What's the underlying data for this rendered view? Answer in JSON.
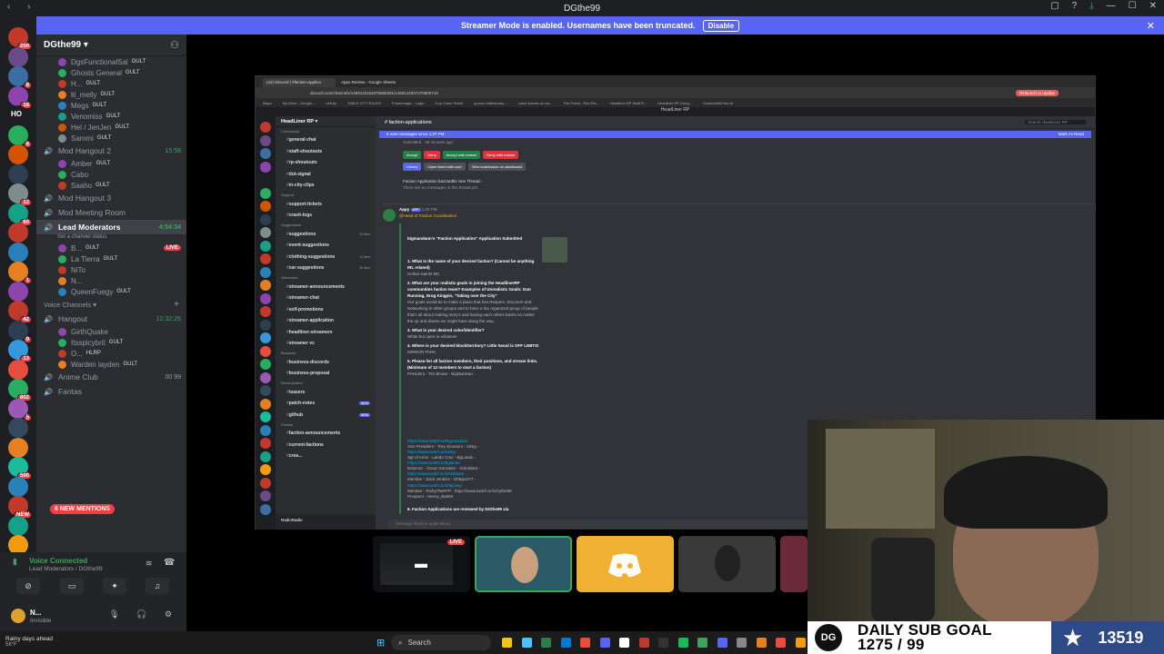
{
  "window": {
    "title": "DGthe99"
  },
  "banner": {
    "text": "Streamer Mode is enabled. Usernames have been truncated.",
    "disable_label": "Disable"
  },
  "rail_badges": [
    "250",
    "8",
    "18",
    "6",
    "HO",
    "12",
    "60",
    "1",
    "42",
    "9",
    "13",
    "802",
    "5",
    "500",
    "NEW"
  ],
  "server": {
    "name": "DGthe99"
  },
  "voice_users_top": [
    {
      "name": "DgsFunctionalSal",
      "tag": "GULT"
    },
    {
      "name": "Ghosts General",
      "tag": "GULT"
    },
    {
      "name": "H...",
      "tag": "GULT"
    },
    {
      "name": "lil_melly",
      "tag": "GULT"
    },
    {
      "name": "Megs",
      "tag": "GULT"
    },
    {
      "name": "Venomiss",
      "tag": "GULT"
    },
    {
      "name": "Hel / JenJen",
      "tag": "GULT"
    },
    {
      "name": "Sammi",
      "tag": "GULT"
    }
  ],
  "mod_hangout_2": {
    "name": "Mod Hangout 2",
    "time": "15:58"
  },
  "mod_hangout_2_users": [
    {
      "name": "Amber",
      "tag": "GULT"
    },
    {
      "name": "Cabo",
      "tag": ""
    },
    {
      "name": "Saaho",
      "tag": "GULT"
    }
  ],
  "mod_hangout_3": {
    "name": "Mod Hangout 3"
  },
  "mod_meeting": {
    "name": "Mod Meeting Room"
  },
  "lead_mods": {
    "name": "Lead Moderators",
    "time": "4:54:34",
    "status": "Set a channel status"
  },
  "lead_mod_users": [
    {
      "name": "B...",
      "tag": "GULT",
      "live": "LIVE"
    },
    {
      "name": "La Tierra",
      "tag": "GULT",
      "live": ""
    },
    {
      "name": "NiTo",
      "tag": "",
      "live": ""
    },
    {
      "name": "N...",
      "tag": "",
      "live": ""
    },
    {
      "name": "QueenFuegy",
      "tag": "GULT",
      "live": ""
    }
  ],
  "voice_cat": {
    "label": "Voice Channels"
  },
  "hangout": {
    "name": "Hangout",
    "time": "12:32:26"
  },
  "hangout_users": [
    {
      "name": "GirthQuake",
      "tag": ""
    },
    {
      "name": "Itsspicybrit",
      "tag": "GULT"
    },
    {
      "name": "O...",
      "tag": "HLRP"
    },
    {
      "name": "Warden layden",
      "tag": "GULT"
    }
  ],
  "anime_club": {
    "name": "Anime Club",
    "count": "00 99"
  },
  "fantasy": {
    "name": "Fantas"
  },
  "mentions": {
    "label": "6 NEW MENTIONS"
  },
  "voice_panel": {
    "title": "Voice Connected",
    "sub": "Lead Moderators / DGthe99"
  },
  "user_panel": {
    "name": "N...",
    "status": "Invisible"
  },
  "stream": {
    "tabs": [
      "(42) Discord | #faction-applica",
      "Apps Review - Google Sheets"
    ],
    "url": "discord.com/channels/1459115162875060291/1459144007270600744",
    "update": "Relaunch to update",
    "bookmarks": [
      "Maps",
      "My Drive - Google...",
      "ocfr.fyi",
      "TABLE CITY RULES",
      "Framemagic - Login",
      "Cop Crime Sheet",
      "queue.entitesrarep...",
      "Label frames on ca...",
      "The Portal - Red Pla...",
      "Headliner RP Staff R...",
      "Headliner RP Gang...",
      "VulmonMAF.live AI"
    ],
    "title": "HeadLiner RP",
    "server_name": "HeadLiner RP",
    "channel": "faction-applications",
    "search": "Search HeadLiner RP",
    "new_messages": "6 new messages since 1:27 PM",
    "mark_read": "Mark As Read",
    "channel_rows": [
      {
        "cat": "Community"
      },
      {
        "name": "general-chat"
      },
      {
        "name": "staff-shoutouts"
      },
      {
        "name": "rp-shoutouts"
      },
      {
        "name": "dot-signal"
      },
      {
        "name": "in-city-clips"
      },
      {
        "cat": "Support"
      },
      {
        "name": "support-tickets"
      },
      {
        "name": "crash-logs"
      },
      {
        "cat": "Suggestions"
      },
      {
        "name": "suggestions",
        "note": "23 New"
      },
      {
        "name": "event-suggestions"
      },
      {
        "name": "clothing-suggestions",
        "note": "11 New"
      },
      {
        "name": "car-suggestions",
        "note": "36 New"
      },
      {
        "cat": "Streamers"
      },
      {
        "name": "streamer-announcements"
      },
      {
        "name": "streamer-chat"
      },
      {
        "name": "self-promotions"
      },
      {
        "name": "streamer-application"
      },
      {
        "name": "headliner-streamers"
      },
      {
        "name": "streamer vc"
      },
      {
        "cat": "Business"
      },
      {
        "name": "business-discords"
      },
      {
        "name": "business-proposal"
      },
      {
        "cat": "Development"
      },
      {
        "name": "teasers"
      },
      {
        "name": "patch-notes",
        "badge": "NEW"
      },
      {
        "name": "github",
        "badge": "NEW"
      },
      {
        "cat": "Faction"
      },
      {
        "name": "faction-announcements"
      },
      {
        "name": "current-factions"
      },
      {
        "name": "crea..."
      }
    ],
    "top_msg": {
      "submitted": "Submitted · 36 minutes ago"
    },
    "actions": [
      "Accept",
      "Deny",
      "Accept with reason",
      "Deny with reason"
    ],
    "actions2": [
      "History",
      "Open ticket with user",
      "View submission on dashboard"
    ],
    "thread": "Faction Application bazzardttv  See Thread ›",
    "thread_sub": "There are no messages in this thread yet.",
    "author": "Appy",
    "author_tag": "APP",
    "author_time": "1:29 PM",
    "mention": "@Head of Faction Coordination",
    "app_title": "bigmandann's \"Faction Application\" Application Submitted",
    "qa": [
      {
        "q": "1. What is the name of your desired faction? (Cannot be anything IRL related)",
        "a": "Hollow Saints MC"
      },
      {
        "q": "2. What are your realistic goals in joining the HeadlinerRP communities faction team? Examples of Unrealistic Goals: Gun Running, Drug Kingpin, \"Taking over the City\"",
        "a": "Our goals would be to make a place that has Respect, Structure and Networking to other groups and to have a fun organized group of people that's all about making story's and having each others backs no matter the up and downs we might have along the way."
      },
      {
        "q": "3. What is your desired color/identifier?",
        "a": "White but open to whatever"
      },
      {
        "q": "4. Where is your desired block/territory? Little Seoul is OFF LIMITS!",
        "a": "MIRROR PARK"
      },
      {
        "q": "5. Please list all faction members, their positions, and stream links. (Minimum of 12 members to start a faction)",
        "a": "President - Tim Brown - BigManDan -"
      }
    ],
    "members": [
      "https://www.twitch.tv/bigmandann",
      "Vice President - Trey Giovanni - x30yy -",
      "https://www.twitch.tv/x30yy",
      "Sgt of Arms - Lando Cruz - BgLando -",
      "https://www.twitch.tv/bglando",
      "Enforcer - Oscar Gonzalez - sinfulslant -",
      "https://www.twitch.tv/sinfulslant",
      "Member - Zack Jenkins - OhBjustYT -",
      "https://www.twitch.tv/ohbjustyt",
      "Member - RichyTheFFP - https://www.twitch.tv/richythe99",
      "Prospect - Henny_Bak69"
    ],
    "q6": "6. Faction Applications are reviewed by DGthe99 via",
    "input": "Message #faction-applications",
    "inner_user": "RadioRadio"
  },
  "tiles": [
    {
      "live": "LIVE"
    },
    {},
    {},
    {}
  ],
  "goal": {
    "logo": "DG",
    "title": "DAILY SUB GOAL",
    "progress": "1275 / 99",
    "count": "13519"
  },
  "taskbar": {
    "weather_1": "Rainy days ahead",
    "weather_2": "58°F",
    "search": "Search"
  }
}
